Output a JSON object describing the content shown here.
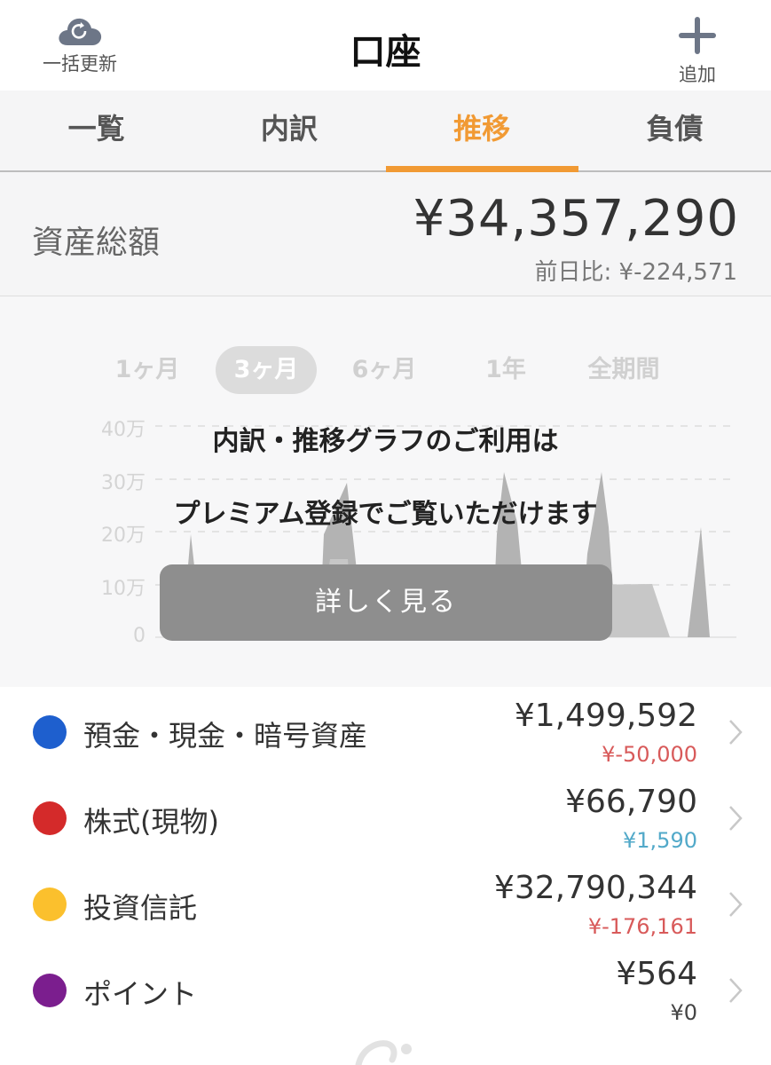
{
  "header": {
    "refresh_label": "一括更新",
    "title": "口座",
    "add_label": "追加"
  },
  "tabs": [
    {
      "label": "一覧"
    },
    {
      "label": "内訳"
    },
    {
      "label": "推移"
    },
    {
      "label": "負債"
    }
  ],
  "summary": {
    "label": "資産総額",
    "amount": "¥34,357,290",
    "diff": "前日比: ¥-224,571"
  },
  "periods": [
    {
      "label": "1ヶ月"
    },
    {
      "label": "3ヶ月"
    },
    {
      "label": "6ヶ月"
    },
    {
      "label": "1年"
    },
    {
      "label": "全期間"
    }
  ],
  "chart": {
    "y_ticks": [
      "40万",
      "30万",
      "20万",
      "10万",
      "0"
    ]
  },
  "premium": {
    "line1": "内訳・推移グラフのご利用は",
    "line2": "プレミアム登録でご覧いただけます",
    "button": "詳しく見る"
  },
  "assets": [
    {
      "name": "預金・現金・暗号資産",
      "amount": "¥1,499,592",
      "change": "¥-50,000",
      "color": "#1e5fce"
    },
    {
      "name": "株式(現物)",
      "amount": "¥66,790",
      "change": "¥1,590",
      "color": "#d42a2a"
    },
    {
      "name": "投資信託",
      "amount": "¥32,790,344",
      "change": "¥-176,161",
      "color": "#fbc02d"
    },
    {
      "name": "ポイント",
      "amount": "¥564",
      "change": "¥0",
      "color": "#7b1e8e"
    }
  ]
}
